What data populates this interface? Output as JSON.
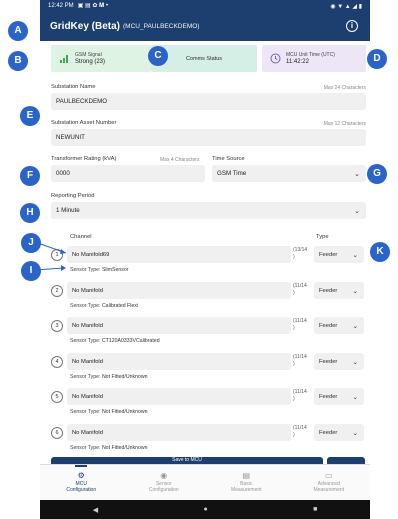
{
  "status_bar": {
    "time": "12:42 PM",
    "battery": "⌂ ◈ ▮ ▲"
  },
  "app_bar": {
    "title": "GridKey (Beta)",
    "subtitle": "(MCU_PAULBECKDEMO)",
    "info_icon": "info-icon"
  },
  "cards": {
    "gsm": {
      "label": "GSM Signal",
      "value": "Strong (23)",
      "icon": "signal-bars-icon"
    },
    "comms": {
      "label": "Comms Status"
    },
    "time": {
      "label": "MCU Unit Time (UTC)",
      "value": "11:42:22",
      "icon": "clock-icon"
    }
  },
  "form": {
    "substation_name": {
      "label": "Substation Name",
      "hint": "Max 24 Characters",
      "value": "PAULBECKDEMO"
    },
    "asset_number": {
      "label": "Substation Asset Number",
      "hint": "Max 12 Characters",
      "value": "NEWUNIT"
    },
    "transformer_rating": {
      "label": "Transformer Rating (kVA)",
      "hint": "Max 4 Characters",
      "value": "0000"
    },
    "time_source": {
      "label": "Time Source",
      "value": "GSM Time"
    },
    "reporting_period": {
      "label": "Reporting Period",
      "value": "1 Minute"
    }
  },
  "channels_header": {
    "channel": "Channel",
    "type": "Type"
  },
  "sensor_type_label": "Sensor Type:",
  "channels": [
    {
      "num": "1",
      "name": "No Manifold69",
      "count": "(13/14",
      "count2": ")",
      "type": "Feeder",
      "sensor": "SlimSensor"
    },
    {
      "num": "2",
      "name": "No Manifold",
      "count": "(11/14",
      "count2": ")",
      "type": "Feeder",
      "sensor": "Calibrated Flexi"
    },
    {
      "num": "3",
      "name": "No Manifold",
      "count": "(11/14",
      "count2": ")",
      "type": "Feeder",
      "sensor": "CT120A0333VCalibrated"
    },
    {
      "num": "4",
      "name": "No Manifold",
      "count": "(11/14",
      "count2": ")",
      "type": "Feeder",
      "sensor": "Not Fitted/Unknown"
    },
    {
      "num": "5",
      "name": "No Manifold",
      "count": "(11/14",
      "count2": ")",
      "type": "Feeder",
      "sensor": "Not Fitted/Unknown"
    },
    {
      "num": "6",
      "name": "No Manifold",
      "count": "(11/14",
      "count2": ")",
      "type": "Feeder",
      "sensor": "Not Fitted/Unknown"
    }
  ],
  "action_bar": {
    "label": "Save to MCU"
  },
  "bottom_nav": [
    {
      "label": "MCU",
      "label2": "Configuration",
      "icon": "gear-icon",
      "active": true
    },
    {
      "label": "Sensor",
      "label2": "Configuration",
      "icon": "sensor-icon",
      "active": false
    },
    {
      "label": "Basic",
      "label2": "Measurement",
      "icon": "document-icon",
      "active": false
    },
    {
      "label": "Advanced",
      "label2": "Measurement",
      "icon": "monitor-icon",
      "active": false
    }
  ],
  "markers": [
    "A",
    "B",
    "C",
    "D",
    "E",
    "F",
    "G",
    "H",
    "J",
    "I",
    "K"
  ],
  "colors": {
    "primary": "#1c3f70",
    "marker": "#2a64c8",
    "gsm_card": "#dff3e4",
    "comms_card": "#d6efe6",
    "time_card": "#ece6f6"
  }
}
